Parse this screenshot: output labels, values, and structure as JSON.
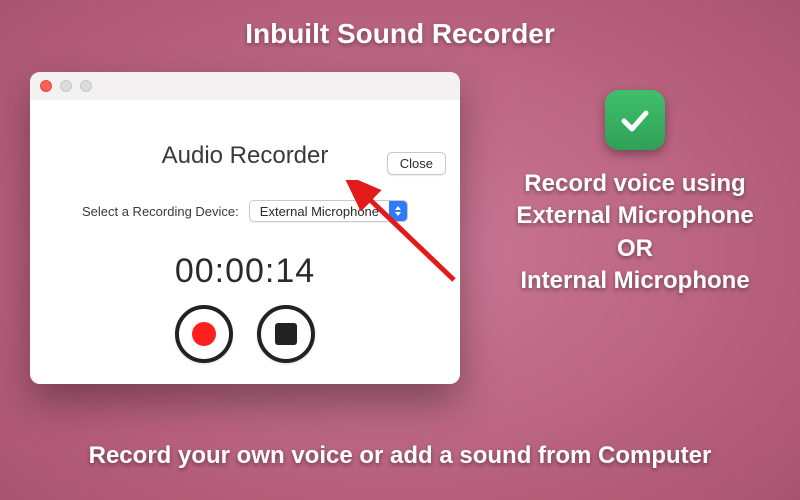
{
  "headline": "Inbuilt Sound Recorder",
  "window": {
    "close_label": "Close",
    "title": "Audio Recorder",
    "device_label": "Select a Recording Device:",
    "device_selected": "External Microphone",
    "timer": "00:00:14"
  },
  "side": {
    "line1": "Record voice using",
    "line2": "External Microphone",
    "line3": "OR",
    "line4": "Internal Microphone"
  },
  "footline": "Record your own voice or add a sound from Computer"
}
